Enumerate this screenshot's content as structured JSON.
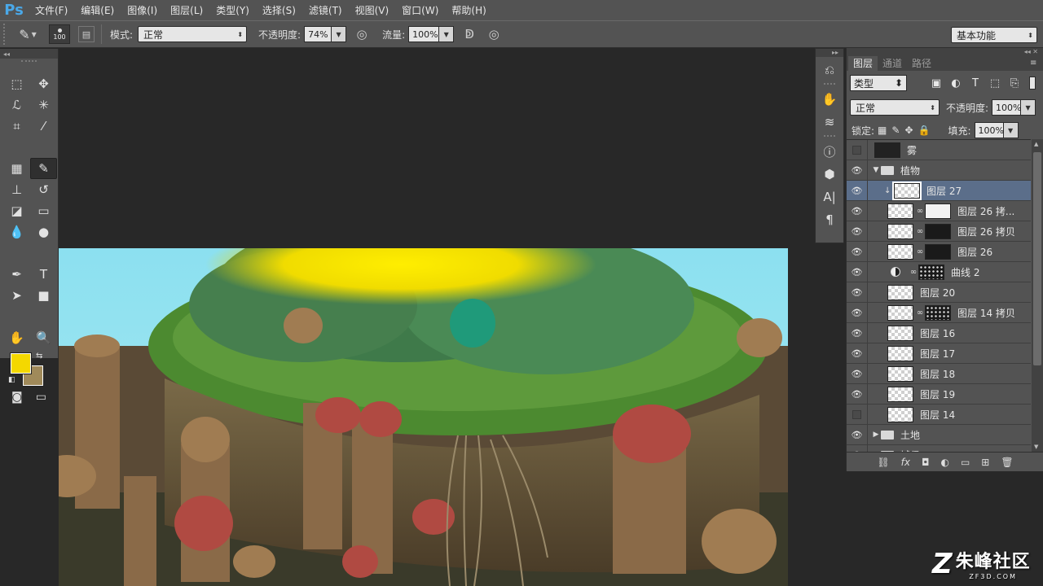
{
  "app": {
    "logo": "Ps"
  },
  "menu": [
    "文件(F)",
    "编辑(E)",
    "图像(I)",
    "图层(L)",
    "类型(Y)",
    "选择(S)",
    "滤镜(T)",
    "视图(V)",
    "窗口(W)",
    "帮助(H)"
  ],
  "options": {
    "brush_size": "100",
    "mode_label": "模式:",
    "mode_value": "正常",
    "opacity_label": "不透明度:",
    "opacity_value": "74%",
    "flow_label": "流量:",
    "flow_value": "100%",
    "workspace": "基本功能"
  },
  "toolbox": {
    "tools": [
      "marquee",
      "move",
      "lasso",
      "magic-wand",
      "crop",
      "eyedropper",
      "healing",
      "brush",
      "stamp",
      "history-brush",
      "eraser",
      "gradient",
      "blur",
      "dodge",
      "pen",
      "type",
      "path-select",
      "shape",
      "hand",
      "zoom"
    ],
    "active_tool": "brush",
    "foreground_color": "#f4d800",
    "background_color": "#a08a5a"
  },
  "layers_panel": {
    "tabs": [
      "图层",
      "通道",
      "路径"
    ],
    "active_tab": "图层",
    "filter_label": "类型",
    "blend_mode": "正常",
    "opacity_label": "不透明度:",
    "opacity_value": "100%",
    "lock_label": "锁定:",
    "fill_label": "填充:",
    "fill_value": "100%",
    "layers": [
      {
        "name": "雾",
        "visible": false,
        "thumb": "dark",
        "indent": 0
      },
      {
        "name": "植物",
        "visible": true,
        "type": "group",
        "expanded": true,
        "indent": 0
      },
      {
        "name": "图层 27",
        "visible": true,
        "thumb": "checker",
        "selected": true,
        "clipped": true,
        "indent": 1
      },
      {
        "name": "图层 26 拷...",
        "visible": true,
        "thumb": "checker",
        "mask": "white",
        "indent": 1
      },
      {
        "name": "图层 26 拷贝",
        "visible": true,
        "thumb": "checker",
        "mask": "dark",
        "indent": 1
      },
      {
        "name": "图层 26",
        "visible": true,
        "thumb": "checker",
        "mask": "dark",
        "indent": 1
      },
      {
        "name": "曲线 2",
        "visible": true,
        "type": "adjustment",
        "mask": "speckle",
        "indent": 1
      },
      {
        "name": "图层 20",
        "visible": true,
        "thumb": "checker",
        "indent": 1
      },
      {
        "name": "图层 14 拷贝",
        "visible": true,
        "thumb": "checker",
        "mask": "speckle",
        "indent": 1
      },
      {
        "name": "图层 16",
        "visible": true,
        "thumb": "checker",
        "indent": 1
      },
      {
        "name": "图层 17",
        "visible": true,
        "thumb": "checker",
        "indent": 1
      },
      {
        "name": "图层 18",
        "visible": true,
        "thumb": "checker",
        "indent": 1
      },
      {
        "name": "图层 19",
        "visible": true,
        "thumb": "checker",
        "indent": 1
      },
      {
        "name": "图层 14",
        "visible": false,
        "thumb": "checker",
        "indent": 1
      },
      {
        "name": "土地",
        "visible": true,
        "type": "group",
        "expanded": false,
        "indent": 0
      },
      {
        "name": "城堡",
        "visible": true,
        "type": "group",
        "expanded": false,
        "indent": 0
      }
    ],
    "footer_icons": [
      "link-icon",
      "fx-icon",
      "mask-icon",
      "adjustment-icon",
      "folder-icon",
      "new-layer-icon",
      "trash-icon"
    ]
  },
  "watermark": {
    "logo": "Z",
    "cn": "朱峰社区",
    "en": "ZF3D.COM"
  }
}
